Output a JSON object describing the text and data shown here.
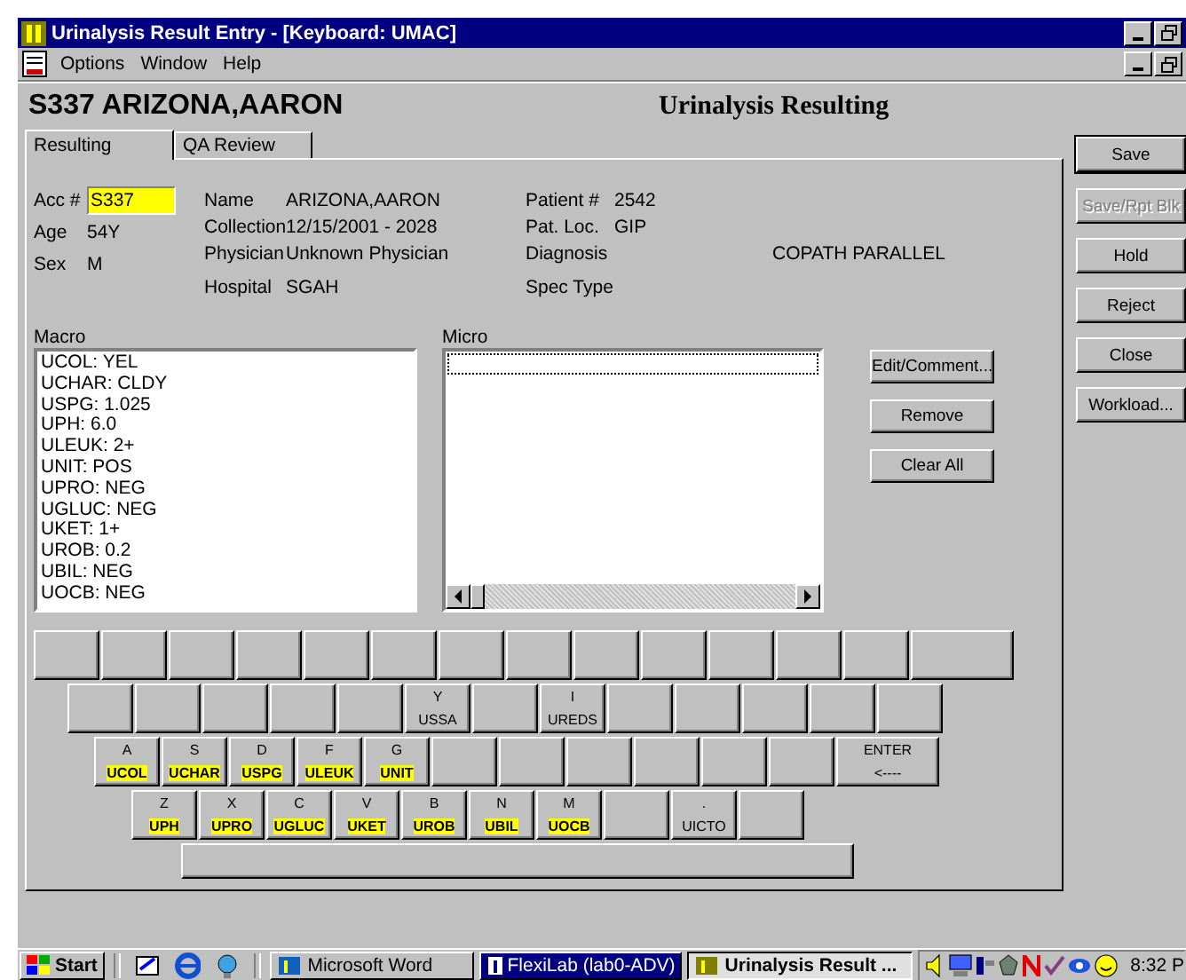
{
  "window": {
    "title": "Urinalysis Result Entry - [Keyboard: UMAC]"
  },
  "menu": [
    "Options",
    "Window",
    "Help"
  ],
  "header": {
    "patient": "S337 ARIZONA,AARON",
    "title": "Urinalysis Resulting"
  },
  "tabs": [
    {
      "label": "Resulting",
      "selected": true
    },
    {
      "label": "QA Review",
      "selected": false
    }
  ],
  "info": {
    "acc_label": "Acc #",
    "acc_value": "S337",
    "age_label": "Age",
    "age": "54Y",
    "sex_label": "Sex",
    "sex": "M",
    "fields": [
      {
        "label": "Name",
        "value": "ARIZONA,AARON"
      },
      {
        "label": "Collection",
        "value": "12/15/2001 - 2028"
      },
      {
        "label": "Physician",
        "value": "Unknown Physician"
      },
      {
        "label": "Hospital",
        "value": "SGAH"
      }
    ],
    "fields2": [
      {
        "label": "Patient #",
        "value": "2542"
      },
      {
        "label": "Pat. Loc.",
        "value": "GIP"
      },
      {
        "label": "Diagnosis",
        "value": "COPATH PARALLEL"
      },
      {
        "label": "Spec Type"
      }
    ]
  },
  "macro": {
    "label": "Macro",
    "items": [
      "UCOL: YEL",
      "UCHAR: CLDY",
      "USPG: 1.025",
      "UPH: 6.0",
      "ULEUK: 2+",
      "UNIT: POS",
      "UPRO: NEG",
      "UGLUC: NEG",
      "UKET: 1+",
      "UROB: 0.2",
      "UBIL: NEG",
      "UOCB: NEG"
    ]
  },
  "micro": {
    "label": "Micro"
  },
  "list_buttons": [
    "Edit/Comment...",
    "Remove",
    "Clear All"
  ],
  "side_buttons": [
    {
      "label": "Save",
      "disabled": false
    },
    {
      "label": "Save/Rpt Blk",
      "disabled": true
    },
    {
      "label": "Hold",
      "disabled": false
    },
    {
      "label": "Reject",
      "disabled": false
    },
    {
      "label": "Close",
      "disabled": false
    },
    {
      "label": "Workload...",
      "disabled": false
    }
  ],
  "keyboard": [
    [
      {
        "kind": "key"
      },
      {
        "kind": "key"
      },
      {
        "kind": "key"
      },
      {
        "kind": "key"
      },
      {
        "kind": "key"
      },
      {
        "kind": "key"
      },
      {
        "kind": "key"
      },
      {
        "kind": "key"
      },
      {
        "kind": "key"
      },
      {
        "kind": "key"
      },
      {
        "kind": "key"
      },
      {
        "kind": "key"
      },
      {
        "kind": "key"
      },
      {
        "kind": "wide"
      }
    ],
    [
      {
        "kind": "key"
      },
      {
        "kind": "key"
      },
      {
        "kind": "key"
      },
      {
        "kind": "key"
      },
      {
        "kind": "key"
      },
      {
        "kind": "key",
        "top": "Y",
        "bottom": "USSA",
        "highlighted": false
      },
      {
        "kind": "key"
      },
      {
        "kind": "key",
        "top": "I",
        "bottom": "UREDS",
        "highlighted": false
      },
      {
        "kind": "key"
      },
      {
        "kind": "key"
      },
      {
        "kind": "key"
      },
      {
        "kind": "key"
      },
      {
        "kind": "key"
      }
    ],
    [
      {
        "kind": "key",
        "top": "A",
        "bottom": "UCOL",
        "highlighted": true
      },
      {
        "kind": "key",
        "top": "S",
        "bottom": "UCHAR",
        "highlighted": true
      },
      {
        "kind": "key",
        "top": "D",
        "bottom": "USPG",
        "highlighted": true
      },
      {
        "kind": "key",
        "top": "F",
        "bottom": "ULEUK",
        "highlighted": true
      },
      {
        "kind": "key",
        "top": "G",
        "bottom": "UNIT",
        "highlighted": true
      },
      {
        "kind": "key"
      },
      {
        "kind": "key"
      },
      {
        "kind": "key"
      },
      {
        "kind": "key"
      },
      {
        "kind": "key"
      },
      {
        "kind": "key"
      },
      {
        "kind": "wide",
        "top": "ENTER",
        "bottom": "<----",
        "highlighted": false
      }
    ],
    [
      {
        "kind": "key",
        "top": "Z",
        "bottom": "UPH",
        "highlighted": true
      },
      {
        "kind": "key",
        "top": "X",
        "bottom": "UPRO",
        "highlighted": true
      },
      {
        "kind": "key",
        "top": "C",
        "bottom": "UGLUC",
        "highlighted": true
      },
      {
        "kind": "key",
        "top": "V",
        "bottom": "UKET",
        "highlighted": true
      },
      {
        "kind": "key",
        "top": "B",
        "bottom": "UROB",
        "highlighted": true
      },
      {
        "kind": "key",
        "top": "N",
        "bottom": "UBIL",
        "highlighted": true
      },
      {
        "kind": "key",
        "top": "M",
        "bottom": "UOCB",
        "highlighted": true
      },
      {
        "kind": "key"
      },
      {
        "kind": "key",
        "top": ".",
        "bottom": "UICTO",
        "highlighted": false
      },
      {
        "kind": "key"
      }
    ],
    [
      {
        "kind": "space"
      }
    ]
  ],
  "taskbar": {
    "start": "Start",
    "tasks": [
      {
        "label": "Microsoft Word",
        "selected": false,
        "flashing": false
      },
      {
        "label": "FlexiLab (lab0-ADV)",
        "selected": false,
        "flashing": true
      },
      {
        "label": "Urinalysis Result ...",
        "selected": true,
        "flashing": false
      }
    ],
    "clock": "8:32 P"
  }
}
